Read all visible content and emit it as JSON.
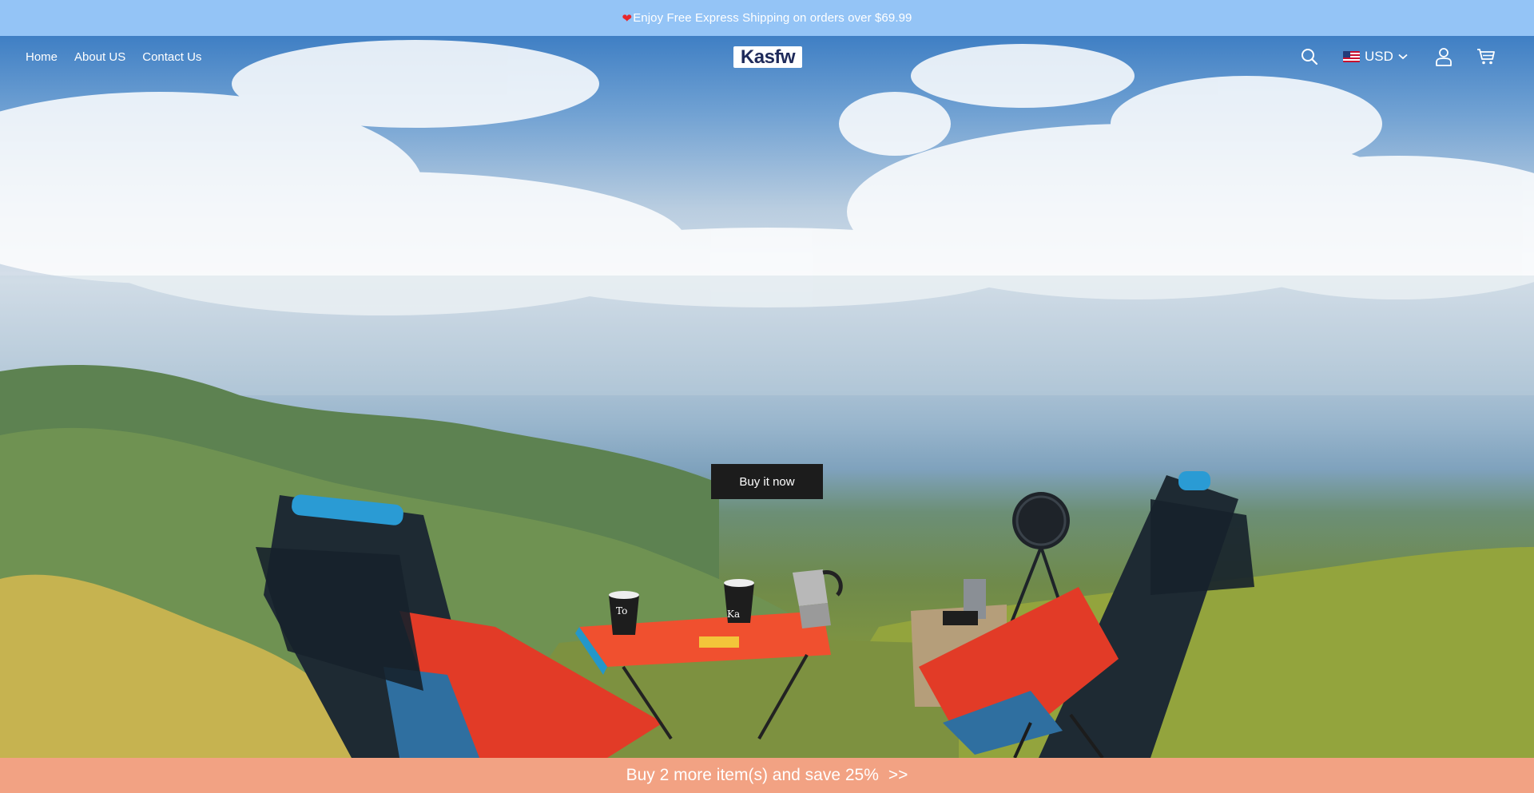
{
  "announcement": {
    "icon": "heart-icon",
    "text": "Enjoy Free Express Shipping on orders over $69.99",
    "icon_color": "#e8262b",
    "bg_color": "#94c4f6"
  },
  "header": {
    "nav": [
      {
        "label": "Home"
      },
      {
        "label": "About US"
      },
      {
        "label": "Contact Us"
      }
    ],
    "logo_text": "Kasfw",
    "currency": {
      "flag_icon": "us-flag-icon",
      "code": "USD"
    },
    "icons": [
      "search-icon",
      "chevron-down-icon",
      "account-icon",
      "cart-icon"
    ]
  },
  "hero": {
    "cta_label": "Buy it now",
    "cup_text_1": "To",
    "cup_text_2": "Ka"
  },
  "promo_bar": {
    "text": "Buy 2 more item(s) and save 25%",
    "arrow": ">>",
    "bg_color": "#f2a283"
  }
}
